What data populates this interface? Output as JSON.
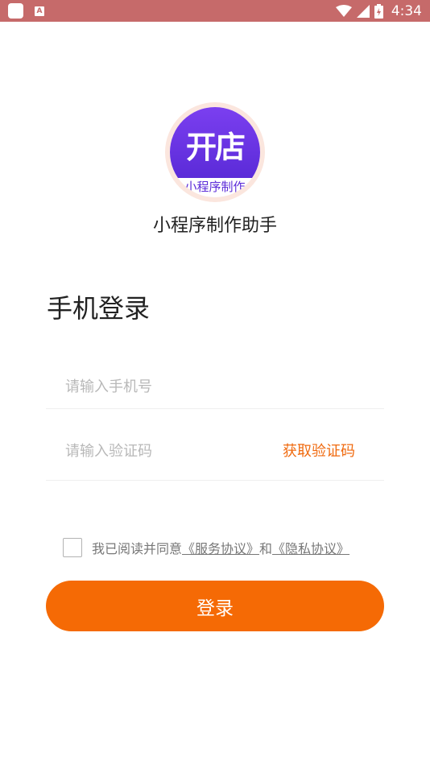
{
  "status_bar": {
    "time": "4:34",
    "icons": [
      "app-icon",
      "a-notification-icon",
      "wifi-icon",
      "signal-icon",
      "battery-icon"
    ],
    "background": "#c66a6a"
  },
  "logo": {
    "main_text": "开店",
    "sub_text": "小程序制作"
  },
  "app_name": "小程序制作助手",
  "login": {
    "title": "手机登录",
    "phone_placeholder": "请输入手机号",
    "code_placeholder": "请输入验证码",
    "get_code_label": "获取验证码",
    "agreement_prefix": "我已阅读并同意",
    "service_link": "《服务协议》",
    "agreement_and": "和",
    "privacy_link": "《隐私协议》",
    "submit_label": "登录",
    "accent_color": "#f56a05"
  }
}
